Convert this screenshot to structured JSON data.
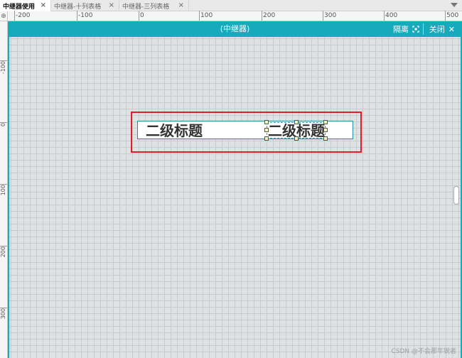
{
  "tabs": [
    {
      "label": "中继器使用",
      "active": true
    },
    {
      "label": "中继器-十列表格",
      "active": false
    },
    {
      "label": "中继器-三列表格",
      "active": false
    }
  ],
  "tab_close_glyph": "×",
  "ruler": {
    "corner_glyph": "⊕",
    "h_labels": [
      "-200",
      "-100",
      "0",
      "100",
      "200",
      "300",
      "400",
      "500"
    ],
    "v_labels": [
      "-100",
      "0",
      "100",
      "200",
      "300"
    ]
  },
  "repeater_panel": {
    "title": "(中继器)",
    "isolate_label": "隔离",
    "close_label": "关闭",
    "close_glyph": "✕",
    "accent_color": "#17a9bc"
  },
  "repeater_items": [
    "二级标题",
    "二级标题"
  ],
  "watermark": "CSDN @不会那年锐者"
}
